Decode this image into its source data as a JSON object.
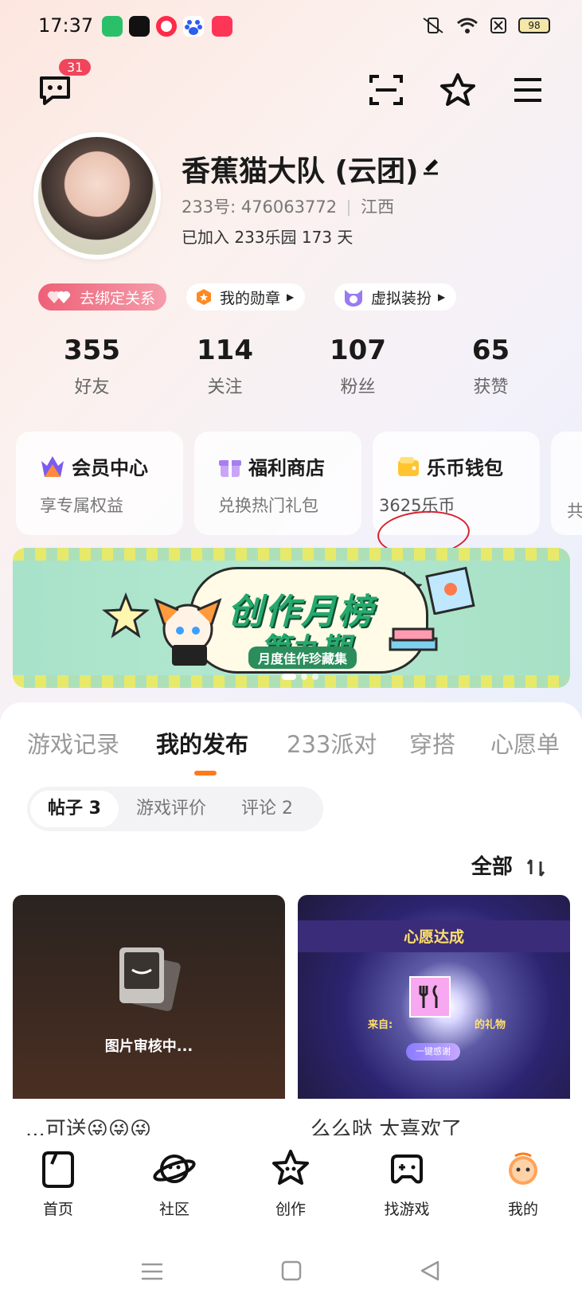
{
  "status_bar": {
    "time": "17:37",
    "battery": "98"
  },
  "header": {
    "message_badge": "31"
  },
  "profile": {
    "name": "香蕉猫大队 (云团)",
    "id_label": "233号: 476063772",
    "region": "江西",
    "joined": "已加入 233乐园 173 天"
  },
  "chips": [
    {
      "label": "去绑定关系"
    },
    {
      "label": "我的勋章"
    },
    {
      "label": "虚拟装扮"
    }
  ],
  "stats": [
    {
      "value": "355",
      "label": "好友"
    },
    {
      "value": "114",
      "label": "关注"
    },
    {
      "value": "107",
      "label": "粉丝"
    },
    {
      "value": "65",
      "label": "获赞"
    }
  ],
  "cards": [
    {
      "title": "会员中心",
      "subtitle": "享专属权益"
    },
    {
      "title": "福利商店",
      "subtitle": "兑换热门礼包"
    },
    {
      "title": "乐币钱包",
      "subtitle": "3625乐币"
    },
    {
      "subtitle": "共"
    }
  ],
  "banner": {
    "line1": "创作月榜",
    "line2": "第九期",
    "line3": "月度佳作珍藏集"
  },
  "tabs": [
    "游戏记录",
    "我的发布",
    "233派对",
    "穿搭",
    "心愿单"
  ],
  "subtabs": [
    "帖子 3",
    "游戏评价",
    "评论 2"
  ],
  "sort_label": "全部",
  "posts": [
    {
      "image_label": "图片审核中...",
      "caption": "...可送😜😜😜"
    },
    {
      "image_title": "心愿达成",
      "from": "来自:",
      "gift": "的礼物",
      "thanks": "一键感谢",
      "caption": "么么哒 太喜欢了"
    }
  ],
  "bottom_nav": [
    {
      "label": "首页"
    },
    {
      "label": "社区"
    },
    {
      "label": "创作"
    },
    {
      "label": "找游戏"
    },
    {
      "label": "我的"
    }
  ],
  "colors": {
    "accent": "#ff7a1a",
    "badge": "#f0455a",
    "annotation": "#d6222e"
  }
}
